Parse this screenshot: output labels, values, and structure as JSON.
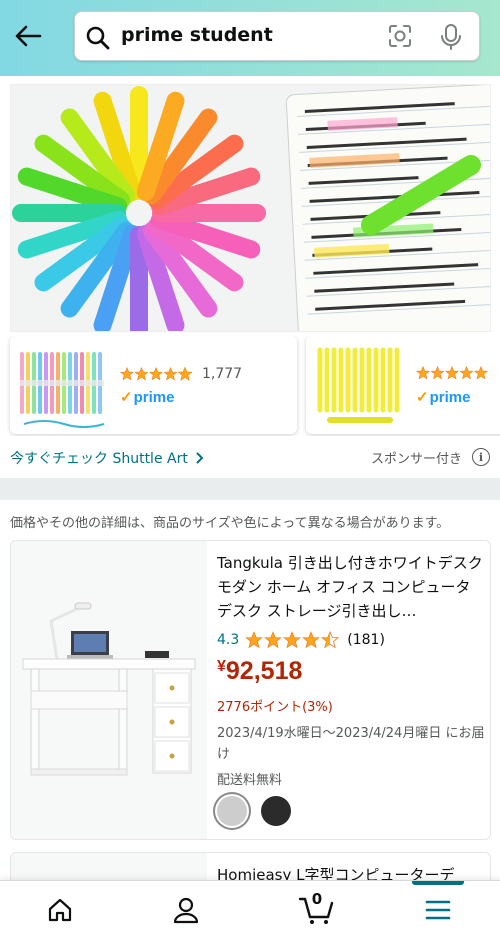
{
  "search": {
    "query": "prime student"
  },
  "sponsored_ad": {
    "products": [
      {
        "rating_count": "1,777",
        "prime_label": "prime"
      },
      {
        "prime_label": "prime"
      }
    ],
    "shop_link": "今すぐチェック Shuttle Art",
    "sponsored_label": "スポンサー付き",
    "info_label": "i"
  },
  "results": {
    "disclaimer": "価格やその他の詳細は、商品のサイズや色によって異なる場合があります。",
    "items": [
      {
        "title": "Tangkula 引き出し付きホワイトデスク モダン ホーム オフィス コンピュータデスク ストレージ引き出し…",
        "rating_value": "4.3",
        "rating_count": "(181)",
        "price_symbol": "¥",
        "price": "92,518",
        "points": "2776ポイント(3%)",
        "delivery": "2023/4/19水曜日～2023/4/24月曜日 にお届け",
        "shipping": "配送料無料",
        "colors": [
          "#cdcdcd",
          "#2b2b2b"
        ]
      },
      {
        "title": "Homieasy L字型コンピューターデ"
      }
    ]
  },
  "bottom_nav": {
    "cart_count": "0"
  },
  "colors": {
    "header_gradient_start": "#82d8e3",
    "header_gradient_end": "#a6e7ce",
    "link": "#007185",
    "price": "#b12704",
    "star": "#ffa41c",
    "prime_blue": "#1a98ff"
  }
}
